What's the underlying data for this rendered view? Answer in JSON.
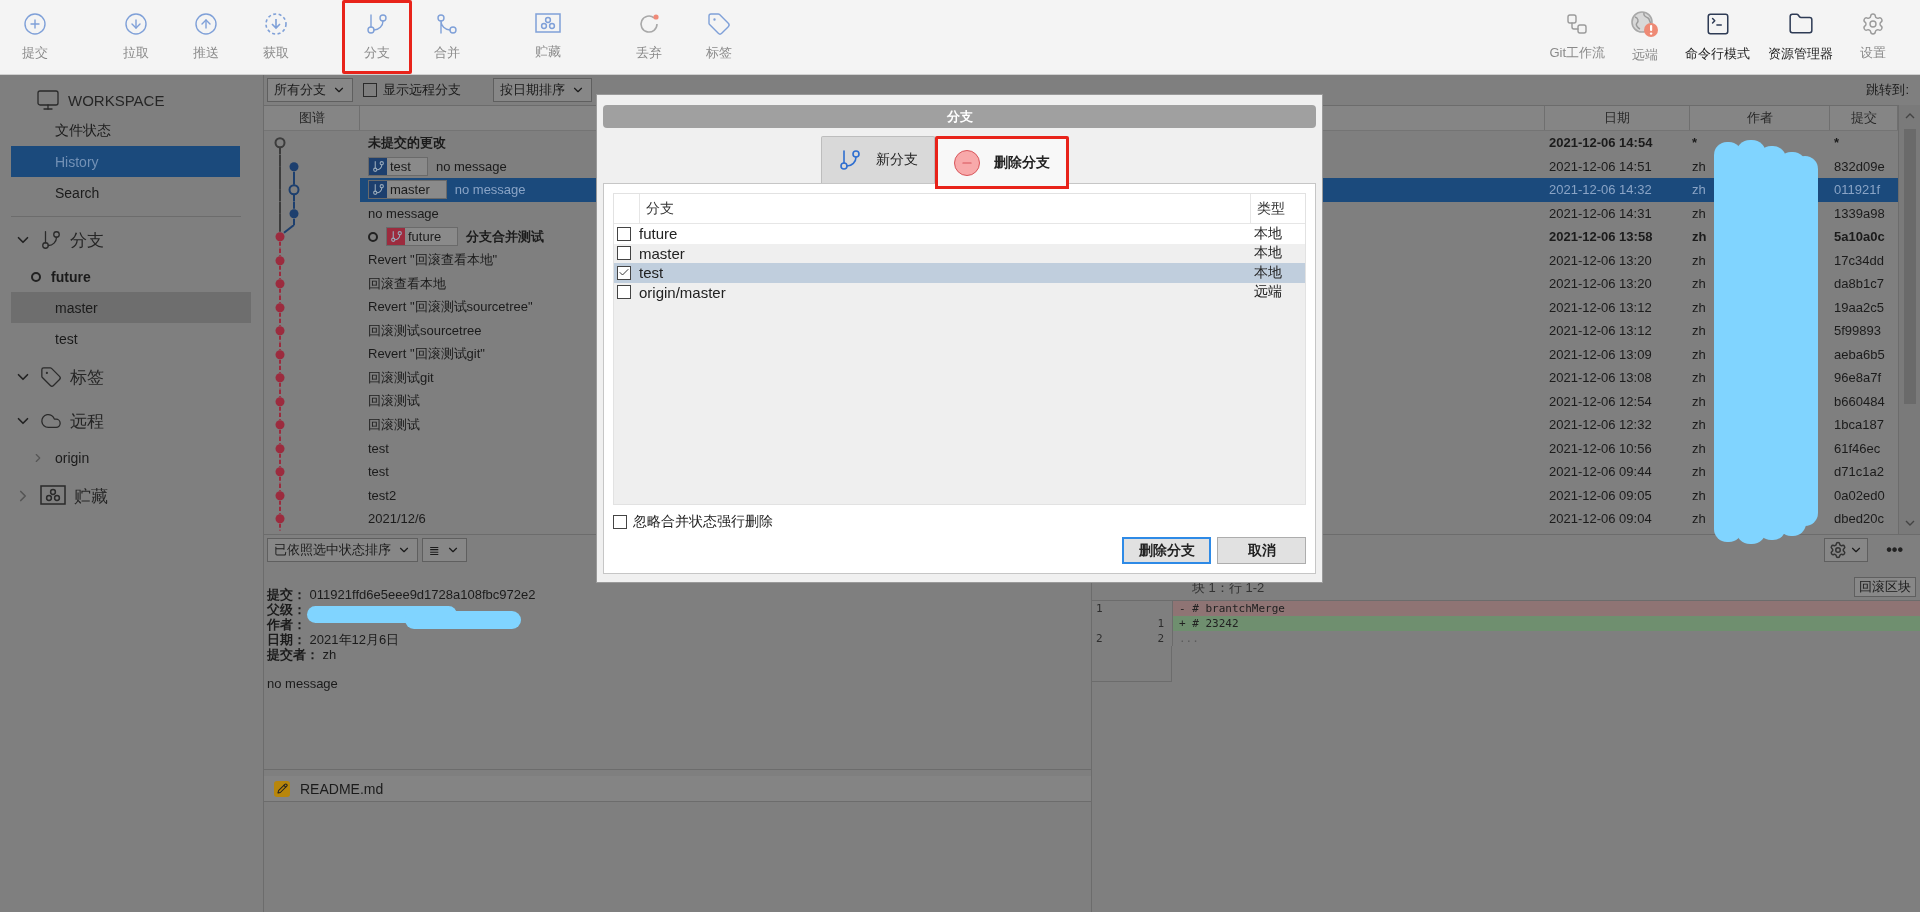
{
  "toolbar": {
    "left_groups": [
      [
        {
          "label": "提交",
          "highlighted": false
        }
      ],
      [
        {
          "label": "拉取",
          "highlighted": false
        },
        {
          "label": "推送",
          "highlighted": false
        },
        {
          "label": "获取",
          "highlighted": false
        }
      ],
      [
        {
          "label": "分支",
          "highlighted": true
        },
        {
          "label": "合并",
          "highlighted": false
        }
      ],
      [
        {
          "label": "贮藏",
          "highlighted": false
        }
      ],
      [
        {
          "label": "丢弃",
          "highlighted": false
        },
        {
          "label": "标签",
          "highlighted": false
        }
      ]
    ],
    "right": [
      {
        "label": "Git工作流",
        "disabled": true
      },
      {
        "label": "远端",
        "disabled": true
      },
      {
        "label": "命令行模式",
        "disabled": false
      },
      {
        "label": "资源管理器",
        "disabled": false
      },
      {
        "label": "设置",
        "disabled": true
      }
    ]
  },
  "sidebar": {
    "workspace": "WORKSPACE",
    "items": [
      {
        "label": "文件状态",
        "selected": false
      },
      {
        "label": "History",
        "selected": true
      },
      {
        "label": "Search",
        "selected": false
      }
    ],
    "sections": [
      {
        "title": "分支",
        "expanded": true,
        "items": [
          {
            "label": "future",
            "selected": false,
            "current": true
          },
          {
            "label": "master",
            "selected": true,
            "current": false
          },
          {
            "label": "test",
            "selected": false,
            "current": false
          }
        ]
      },
      {
        "title": "标签",
        "expanded": true
      },
      {
        "title": "远程",
        "expanded": true,
        "items": [
          {
            "label": "origin",
            "selected": false,
            "current": false,
            "expanded": false
          }
        ]
      },
      {
        "title": "贮藏",
        "expanded": false
      }
    ]
  },
  "filter_bar": {
    "branches": "所有分支",
    "show_remote": {
      "label": "显示远程分支",
      "checked": false
    },
    "sort": "按日期排序",
    "jump_label": "跳转到:"
  },
  "history": {
    "graph_header": "图谱",
    "date_header": "日期",
    "author_header": "作者",
    "hash_header": "提交",
    "rows": [
      {
        "hollow": true,
        "side": false,
        "color": "#3c3c3c",
        "message": "未提交的更改",
        "bold": true,
        "selected": false,
        "date": "2021-12-06 14:54",
        "author": "*",
        "hash": "*"
      },
      {
        "hollow": false,
        "side": true,
        "color": "#1d3f6e",
        "refs": [
          {
            "name": "test",
            "color": "#1d3f6e",
            "head": false
          }
        ],
        "message": "no message",
        "bold": false,
        "selected": false,
        "date": "2021-12-06 14:51",
        "author": "zh",
        "hash": "832d09e"
      },
      {
        "hollow": true,
        "side": true,
        "color": "#1d3f6e",
        "refs": [
          {
            "name": "master",
            "color": "#1d3f6e",
            "head": false
          }
        ],
        "message": "no message",
        "bold": false,
        "selected": true,
        "date": "2021-12-06 14:32",
        "author": "zh",
        "hash": "011921f"
      },
      {
        "hollow": false,
        "side": true,
        "color": "#1d3f6e",
        "message": "no message",
        "bold": false,
        "selected": false,
        "date": "2021-12-06 14:31",
        "author": "zh",
        "hash": "1339a98"
      },
      {
        "hollow": false,
        "side": false,
        "color": "#9c2b3e",
        "refs": [
          {
            "name": "future",
            "color": "#9c2b3e",
            "head": true
          }
        ],
        "message": "分支合并测试",
        "bold": true,
        "selected": false,
        "date": "2021-12-06 13:58",
        "author": "zh",
        "hash": "5a10a0c"
      },
      {
        "hollow": false,
        "side": false,
        "color": "#9c2b3e",
        "message": "Revert \"回滚查看本地\"",
        "bold": false,
        "selected": false,
        "date": "2021-12-06 13:20",
        "author": "zh",
        "hash": "17c34dd"
      },
      {
        "hollow": false,
        "side": false,
        "color": "#9c2b3e",
        "message": "回滚查看本地",
        "bold": false,
        "selected": false,
        "date": "2021-12-06 13:20",
        "author": "zh",
        "hash": "da8b1c7"
      },
      {
        "hollow": false,
        "side": false,
        "color": "#9c2b3e",
        "message": "Revert \"回滚测试sourcetree\"",
        "bold": false,
        "selected": false,
        "date": "2021-12-06 13:12",
        "author": "zh",
        "hash": "19aa2c5"
      },
      {
        "hollow": false,
        "side": false,
        "color": "#9c2b3e",
        "message": "回滚测试sourcetree",
        "bold": false,
        "selected": false,
        "date": "2021-12-06 13:12",
        "author": "zh",
        "hash": "5f99893"
      },
      {
        "hollow": false,
        "side": false,
        "color": "#9c2b3e",
        "message": "Revert \"回滚测试git\"",
        "bold": false,
        "selected": false,
        "date": "2021-12-06 13:09",
        "author": "zh",
        "hash": "aeba6b5"
      },
      {
        "hollow": false,
        "side": false,
        "color": "#9c2b3e",
        "message": "回滚测试git",
        "bold": false,
        "selected": false,
        "date": "2021-12-06 13:08",
        "author": "zh",
        "hash": "96e8a7f"
      },
      {
        "hollow": false,
        "side": false,
        "color": "#9c2b3e",
        "message": "回滚测试",
        "bold": false,
        "selected": false,
        "date": "2021-12-06 12:54",
        "author": "zh",
        "hash": "b660484"
      },
      {
        "hollow": false,
        "side": false,
        "color": "#9c2b3e",
        "message": "回滚测试",
        "bold": false,
        "selected": false,
        "date": "2021-12-06 12:32",
        "author": "zh",
        "hash": "1bca187"
      },
      {
        "hollow": false,
        "side": false,
        "color": "#9c2b3e",
        "message": "test",
        "bold": false,
        "selected": false,
        "date": "2021-12-06 10:56",
        "author": "zh",
        "hash": "61f46ec"
      },
      {
        "hollow": false,
        "side": false,
        "color": "#9c2b3e",
        "message": "test",
        "bold": false,
        "selected": false,
        "date": "2021-12-06 09:44",
        "author": "zh",
        "hash": "d71c1a2"
      },
      {
        "hollow": false,
        "side": false,
        "color": "#9c2b3e",
        "message": "test2",
        "bold": false,
        "selected": false,
        "date": "2021-12-06 09:05",
        "author": "zh",
        "hash": "0a02ed0"
      },
      {
        "hollow": false,
        "side": false,
        "color": "#9c2b3e",
        "message": "2021/12/6",
        "bold": false,
        "selected": false,
        "date": "2021-12-06 09:04",
        "author": "zh",
        "hash": "dbed20c"
      }
    ]
  },
  "details": {
    "sort": "已依照选中状态排序",
    "view_button": "≣",
    "fields": [
      {
        "label": "提交：",
        "value": "011921ffd6e5eee9d1728a108fbc972e2"
      },
      {
        "label": "父级："
      },
      {
        "label": "作者："
      },
      {
        "label": "日期：",
        "value": "2021年12月6日"
      },
      {
        "label": "提交者：",
        "value": "zh"
      }
    ],
    "message": "no message",
    "files": [
      {
        "name": "README.md"
      }
    ]
  },
  "diff": {
    "more_button": "•••",
    "hunk": "块 1：行 1-2",
    "revert_button": "回滚区块",
    "lines": [
      {
        "kind": "removed",
        "old": "1",
        "text": "- # brantchMerge"
      },
      {
        "kind": "added",
        "new": "1",
        "text": "+ # 23242"
      },
      {
        "kind": "context",
        "old": "2",
        "new": "2",
        "text": "..."
      }
    ]
  },
  "dialog": {
    "title": "分支",
    "tabs": [
      {
        "label": "新分支",
        "selected": false,
        "highlighted": false
      },
      {
        "label": "删除分支",
        "selected": true,
        "highlighted": true
      }
    ],
    "branch_header": "分支",
    "type_header": "类型",
    "branches": [
      {
        "name": "future",
        "type": "本地",
        "checked": false,
        "selected": false
      },
      {
        "name": "master",
        "type": "本地",
        "checked": false,
        "selected": false
      },
      {
        "name": "test",
        "type": "本地",
        "checked": true,
        "selected": true
      },
      {
        "name": "origin/master",
        "type": "远端",
        "checked": false,
        "selected": false
      }
    ],
    "force": {
      "label": "忽略合并状态强行删除",
      "checked": false
    },
    "buttons": [
      {
        "label": "删除分支",
        "primary": true
      },
      {
        "label": "取消",
        "primary": false
      }
    ]
  }
}
